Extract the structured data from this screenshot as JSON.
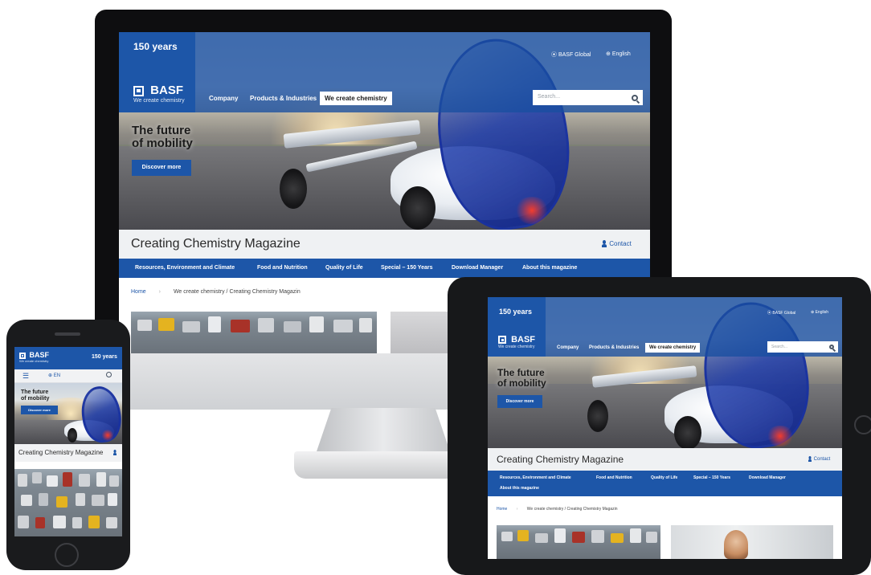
{
  "brand": {
    "anniversary": "150 years",
    "name": "BASF",
    "tagline": "We create chemistry",
    "accent": "#1d56a8"
  },
  "utility": {
    "global_label": "BASF Global",
    "language_label": "English",
    "mobile_language": "EN",
    "icons": [
      "location-pin-icon",
      "globe-icon",
      "search-icon",
      "menu-icon",
      "person-icon"
    ]
  },
  "nav": {
    "items": [
      "Company",
      "Products & Industries",
      "We create chemistry"
    ],
    "active": "We create chemistry"
  },
  "search": {
    "placeholder": "Search..."
  },
  "hero": {
    "headline_line1": "The future",
    "headline_line2": "of mobility",
    "cta": "Discover more"
  },
  "magazine": {
    "title": "Creating Chemistry Magazine",
    "contact": "Contact",
    "categories": [
      "Resources, Environment and Climate",
      "Food and Nutrition",
      "Quality of Life",
      "Special – 150 Years",
      "Download Manager",
      "About this magazine"
    ]
  },
  "breadcrumb": {
    "home": "Home",
    "desktop_path": "We create chemistry / Creating Chemistry Magazin",
    "tablet_path": "We create chemistry / Creating Chemistry Magazin"
  }
}
